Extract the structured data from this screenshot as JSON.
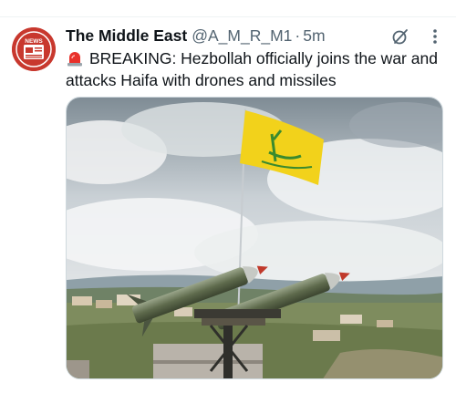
{
  "tweet": {
    "author": {
      "display_name": "The Middle East",
      "handle": "@A_M_R_M1",
      "avatar_label": "NEWS",
      "avatar_icon": "news-logo-icon"
    },
    "separator": "·",
    "timestamp": "5m",
    "text": "BREAKING: Hezbollah officially joins the war and attacks Haifa with drones and missiles",
    "text_prefix_icon": "rotating-light-icon",
    "media": {
      "description_icon": "photo-missiles-flag-icon"
    },
    "actions": {
      "grok_icon": "grok-icon",
      "more_icon": "more-icon"
    }
  },
  "colors": {
    "avatar_bg": "#c8382e",
    "secondary_text": "#536471",
    "flag_yellow": "#f2d21b",
    "flag_green": "#3a8a2e"
  }
}
